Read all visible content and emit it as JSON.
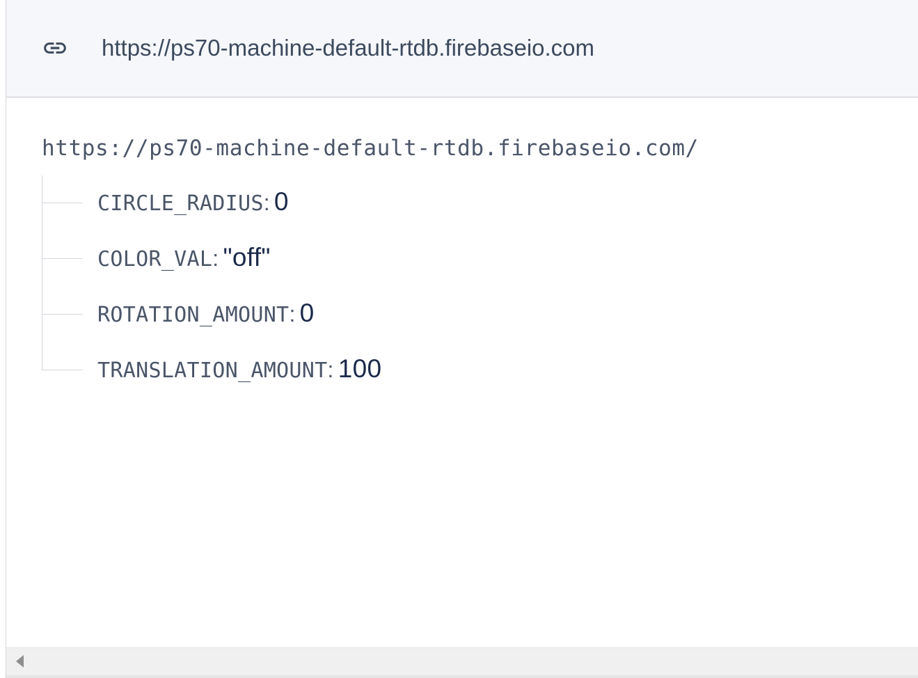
{
  "header": {
    "icon": "link-icon",
    "url": "https://ps70-machine-default-rtdb.firebaseio.com"
  },
  "tree": {
    "root": "https://ps70-machine-default-rtdb.firebaseio.com/",
    "separator": ":",
    "entries": [
      {
        "key": "CIRCLE_RADIUS",
        "value": "0"
      },
      {
        "key": "COLOR_VAL",
        "value": "\"off\""
      },
      {
        "key": "ROTATION_AMOUNT",
        "value": "0"
      },
      {
        "key": "TRANSLATION_AMOUNT",
        "value": "100"
      }
    ]
  },
  "scrollbar": {
    "icon": "scroll-left-arrow-icon"
  },
  "colors": {
    "header_bg": "#f6f7fa",
    "key_text": "#4a5568",
    "value_text": "#1b2a4a"
  }
}
